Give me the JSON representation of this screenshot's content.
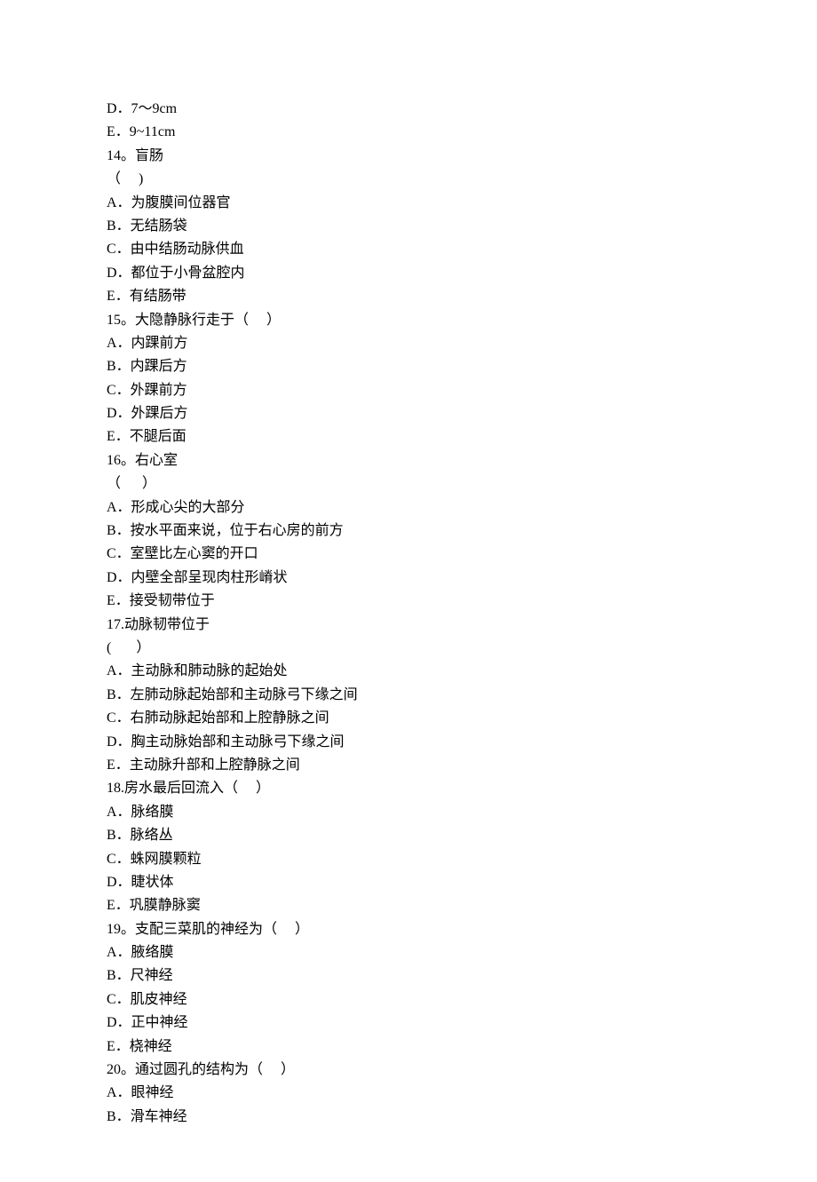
{
  "lines": [
    "D．7～9cm",
    "E．9~11cm",
    "14。盲肠",
    "（     )",
    "A．为腹膜间位器官",
    "B．无结肠袋",
    "C．由中结肠动脉供血",
    "D．都位于小骨盆腔内",
    "E．有结肠带",
    "15。大隐静脉行走于（     ）",
    "A．内踝前方",
    "B．内踝后方",
    "C．外踝前方",
    "D．外踝后方",
    "E．不腿后面",
    "16。右心室",
    "（      ）",
    "A．形成心尖的大部分",
    "B．按水平面来说，位于右心房的前方",
    "C．室壁比左心窦的开口",
    "D．内壁全部呈现肉柱形嵴状",
    "E．接受韧带位于",
    "17.动脉韧带位于",
    "(       ）",
    "A．主动脉和肺动脉的起始处",
    "B．左肺动脉起始部和主动脉弓下缘之间",
    "C．右肺动脉起始部和上腔静脉之间",
    "D．胸主动脉始部和主动脉弓下缘之间",
    "E．主动脉升部和上腔静脉之间",
    "18.房水最后回流入（     ）",
    "A．脉络膜",
    "B．脉络丛",
    "C．蛛网膜颗粒",
    "D．睫状体",
    "E．巩膜静脉窦",
    "19。支配三菜肌的神经为（     ）",
    "A．腋络膜",
    "B．尺神经",
    "C．肌皮神经",
    "D．正中神经",
    "E．桡神经",
    "20。通过圆孔的结构为（     ）",
    "A．眼神经",
    "B．滑车神经"
  ]
}
